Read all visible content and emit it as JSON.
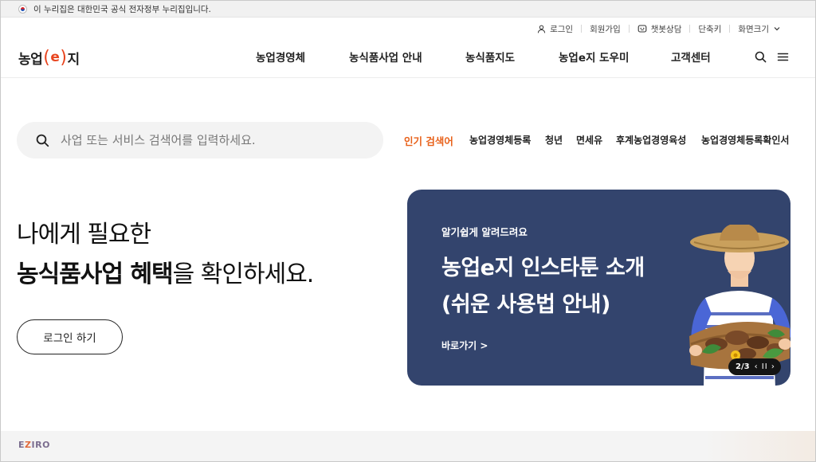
{
  "gov_banner": {
    "text": "이 누리집은 대한민국 공식 전자정부 누리집입니다."
  },
  "utility": {
    "login": "로그인",
    "signup": "회원가입",
    "chatbot": "챗봇상담",
    "shortcut_keys": "단축키",
    "screen_size": "화면크기"
  },
  "logo": {
    "part1": "농업",
    "open": "(",
    "e": "e",
    "close": ")",
    "part2": "지"
  },
  "nav": [
    {
      "label": "농업경영체"
    },
    {
      "label": "농식품사업 안내"
    },
    {
      "label": "농식품지도"
    },
    {
      "label": "농업e지 도우미"
    },
    {
      "label": "고객센터"
    }
  ],
  "search": {
    "placeholder": "사업 또는 서비스 검색어를 입력하세요."
  },
  "popular": {
    "title": "인기 검색어",
    "keywords": [
      "농업경영체등록",
      "청년",
      "면세유",
      "후계농업경영육성",
      "농업경영체등록확인서"
    ]
  },
  "hero": {
    "line1": "나에게 필요한",
    "line2_bold": "농식품사업 혜택",
    "line2_rest": "을 확인하세요.",
    "login_button": "로그인 하기"
  },
  "banner": {
    "eyebrow": "알기쉽게 알려드려요",
    "title_line1": "농업e지 인스타툰 소개",
    "title_line2": "(쉬운 사용법 안내)",
    "link": "바로가기 >",
    "pager": "2/3",
    "pager_controls": "‹ II ›",
    "bg_color": "#33446d"
  },
  "footer": {
    "brand_e": "E",
    "brand_z": "Z",
    "brand_rest": "IRO"
  },
  "colors": {
    "accent": "#e8451f",
    "popular": "#e8611a"
  }
}
